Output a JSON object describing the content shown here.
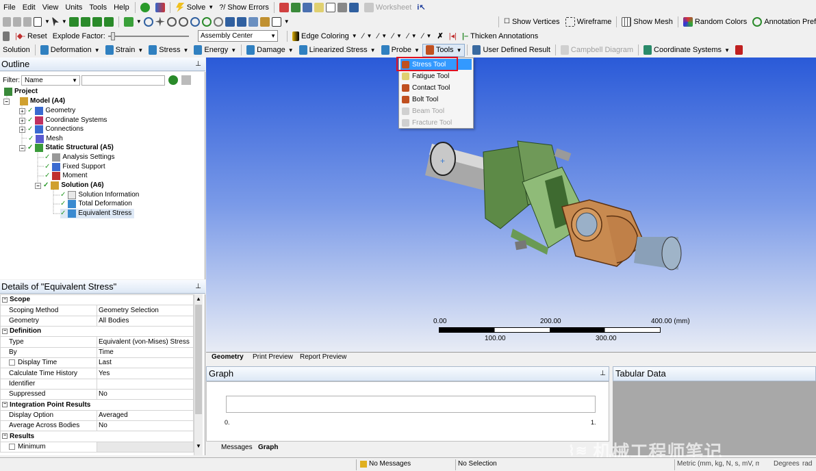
{
  "menubar": {
    "items": [
      "File",
      "Edit",
      "View",
      "Units",
      "Tools",
      "Help"
    ],
    "solve": "Solve",
    "show_errors": "Show Errors",
    "worksheet": "Worksheet"
  },
  "toolbar2": {
    "show_vertices": "Show Vertices",
    "wireframe": "Wireframe",
    "show_mesh": "Show Mesh",
    "random_colors": "Random Colors",
    "annotation_prefs": "Annotation Prefe"
  },
  "toolbar3": {
    "reset": "Reset",
    "explode_factor": "Explode Factor:",
    "assembly_center": "Assembly Center",
    "edge_coloring": "Edge Coloring",
    "thicken_annotations": "Thicken Annotations"
  },
  "toolbar4": {
    "solution": "Solution",
    "deformation": "Deformation",
    "strain": "Strain",
    "stress": "Stress",
    "energy": "Energy",
    "damage": "Damage",
    "linearized_stress": "Linearized Stress",
    "probe": "Probe",
    "tools": "Tools",
    "user_defined_result": "User Defined Result",
    "campbell_diagram": "Campbell Diagram",
    "coordinate_systems": "Coordinate Systems"
  },
  "tools_menu": [
    "Stress Tool",
    "Fatigue Tool",
    "Contact Tool",
    "Bolt Tool",
    "Beam Tool",
    "Fracture Tool"
  ],
  "outline": {
    "title": "Outline",
    "filter_label": "Filter:",
    "filter_value": "Name",
    "tree": [
      "Project",
      "Model (A4)",
      "Geometry",
      "Coordinate Systems",
      "Connections",
      "Mesh",
      "Static Structural (A5)",
      "Analysis Settings",
      "Fixed Support",
      "Moment",
      "Solution (A6)",
      "Solution Information",
      "Total Deformation",
      "Equivalent Stress"
    ]
  },
  "details": {
    "title": "Details of \"Equivalent Stress\"",
    "rows": [
      {
        "k": "Scope",
        "v": "",
        "g": true
      },
      {
        "k": "Scoping Method",
        "v": "Geometry Selection"
      },
      {
        "k": "Geometry",
        "v": "All Bodies"
      },
      {
        "k": "Definition",
        "v": "",
        "g": true
      },
      {
        "k": "Type",
        "v": "Equivalent (von-Mises) Stress"
      },
      {
        "k": "By",
        "v": "Time"
      },
      {
        "k": "Display Time",
        "v": "Last",
        "cb": true
      },
      {
        "k": "Calculate Time History",
        "v": "Yes"
      },
      {
        "k": "Identifier",
        "v": ""
      },
      {
        "k": "Suppressed",
        "v": "No"
      },
      {
        "k": "Integration Point Results",
        "v": "",
        "g": true
      },
      {
        "k": "Display Option",
        "v": "Averaged"
      },
      {
        "k": "Average Across Bodies",
        "v": "No"
      },
      {
        "k": "Results",
        "v": "",
        "g": true
      },
      {
        "k": "Minimum",
        "v": "",
        "cb": true
      }
    ]
  },
  "scale": {
    "top": [
      "0.00",
      "200.00",
      "400.00 (mm)"
    ],
    "bottom": [
      "100.00",
      "300.00"
    ]
  },
  "view_tabs": [
    "Geometry",
    "Print Preview",
    "Report Preview"
  ],
  "graph": {
    "title": "Graph",
    "x0": "0.",
    "x1": "1."
  },
  "bottom_tabs": [
    "Messages",
    "Graph"
  ],
  "tabular_title": "Tabular Data",
  "status": {
    "messages": "No Messages",
    "selection": "No Selection",
    "units": "Metric (mm, kg, N, s, mV, mA)",
    "angle": "Degrees",
    "extra": "rad"
  },
  "watermark": "机械工程师笔记"
}
